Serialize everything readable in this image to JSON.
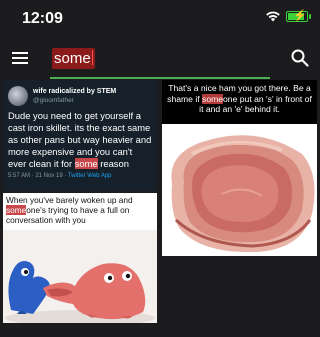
{
  "status": {
    "time": "12:09",
    "battery_level": 0.8
  },
  "search": {
    "query": "some"
  },
  "results": [
    {
      "kind": "tweet",
      "author": "wife radicalized by STEM",
      "handle": "@gloomfather",
      "text_before": "Dude you need to get yourself a cast iron skillet. its the exact same as other pans but way heavier and more expensive and you can't ever clean it for ",
      "highlight": "some",
      "text_after": " reason",
      "timestamp": "5:57 AM · 21 Nov 19 · ",
      "app": "Twitter Web App"
    },
    {
      "kind": "meme",
      "caption_before": "That's a nice ham you got there. Be a shame if ",
      "highlight": "some",
      "caption_after": "one put an 's' in front of it and an 'e' behind it."
    },
    {
      "kind": "meme",
      "caption_before": "When you've barely woken up and ",
      "highlight": "some",
      "caption_after": "one's trying to have a full on conversation with you"
    }
  ],
  "colors": {
    "accent_green": "#4caf50",
    "highlight_red": "#c8474a",
    "search_highlight": "#8b1a1a"
  }
}
